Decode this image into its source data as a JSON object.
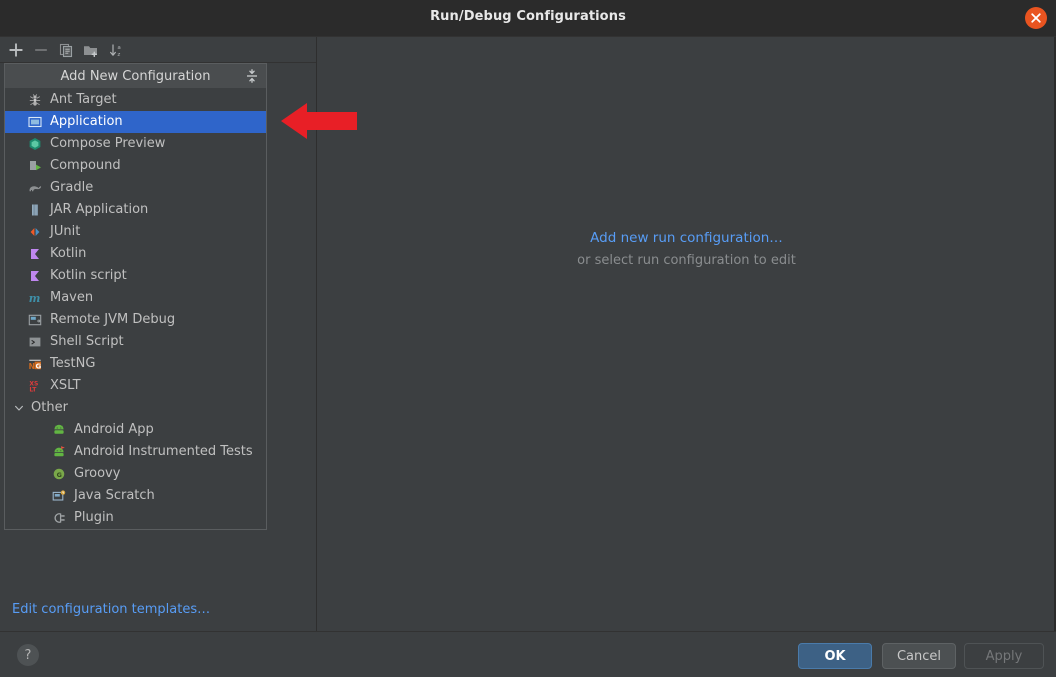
{
  "window": {
    "title": "Run/Debug Configurations",
    "close_icon": "close-icon"
  },
  "toolbar": {
    "buttons": [
      {
        "name": "add-configuration-button",
        "icon": "plus-icon",
        "label": "+"
      },
      {
        "name": "remove-configuration-button",
        "icon": "minus-icon",
        "label": "−"
      },
      {
        "name": "copy-configuration-button",
        "icon": "copy-icon",
        "label": ""
      },
      {
        "name": "new-folder-button",
        "icon": "folder-add-icon",
        "label": ""
      },
      {
        "name": "sort-configurations-button",
        "icon": "sort-alphabetical-icon",
        "label": ""
      }
    ]
  },
  "popup": {
    "header_title": "Add New Configuration",
    "header_icon": "collapse-expand-icon",
    "items": [
      {
        "label": "Ant Target",
        "icon": "ant-icon",
        "indent": 0,
        "selected": false
      },
      {
        "label": "Application",
        "icon": "application-icon",
        "indent": 0,
        "selected": true
      },
      {
        "label": "Compose Preview",
        "icon": "compose-icon",
        "indent": 0,
        "selected": false
      },
      {
        "label": "Compound",
        "icon": "compound-icon",
        "indent": 0,
        "selected": false
      },
      {
        "label": "Gradle",
        "icon": "gradle-icon",
        "indent": 0,
        "selected": false
      },
      {
        "label": "JAR Application",
        "icon": "jar-icon",
        "indent": 0,
        "selected": false
      },
      {
        "label": "JUnit",
        "icon": "junit-icon",
        "indent": 0,
        "selected": false
      },
      {
        "label": "Kotlin",
        "icon": "kotlin-icon",
        "indent": 0,
        "selected": false
      },
      {
        "label": "Kotlin script",
        "icon": "kotlin-script-icon",
        "indent": 0,
        "selected": false
      },
      {
        "label": "Maven",
        "icon": "maven-icon",
        "indent": 0,
        "selected": false
      },
      {
        "label": "Remote JVM Debug",
        "icon": "remote-debug-icon",
        "indent": 0,
        "selected": false
      },
      {
        "label": "Shell Script",
        "icon": "shell-script-icon",
        "indent": 0,
        "selected": false
      },
      {
        "label": "TestNG",
        "icon": "testng-icon",
        "indent": 0,
        "selected": false
      },
      {
        "label": "XSLT",
        "icon": "xslt-icon",
        "indent": 0,
        "selected": false
      },
      {
        "label": "Other",
        "icon": "chevron-down-icon",
        "indent": 0,
        "selected": false,
        "group": true
      },
      {
        "label": "Android App",
        "icon": "android-icon",
        "indent": 1,
        "selected": false
      },
      {
        "label": "Android Instrumented Tests",
        "icon": "android-test-icon",
        "indent": 1,
        "selected": false
      },
      {
        "label": "Groovy",
        "icon": "groovy-icon",
        "indent": 1,
        "selected": false
      },
      {
        "label": "Java Scratch",
        "icon": "java-scratch-icon",
        "indent": 1,
        "selected": false
      },
      {
        "label": "Plugin",
        "icon": "plugin-icon",
        "indent": 1,
        "selected": false
      }
    ]
  },
  "left_panel": {
    "templates_link": "Edit configuration templates…"
  },
  "right_panel": {
    "add_link": "Add new run configuration…",
    "hint": "or select run configuration to edit"
  },
  "bottom_bar": {
    "help_label": "?",
    "ok_label": "OK",
    "cancel_label": "Cancel",
    "apply_label": "Apply"
  },
  "annotation": {
    "arrow": "left-pointing-arrow",
    "color": "#e81f26"
  },
  "colors": {
    "selection": "#2f65ca",
    "link": "#589df6",
    "accent_close": "#e95420",
    "background": "#3c3f41",
    "titlebar": "#2b2b2b"
  }
}
